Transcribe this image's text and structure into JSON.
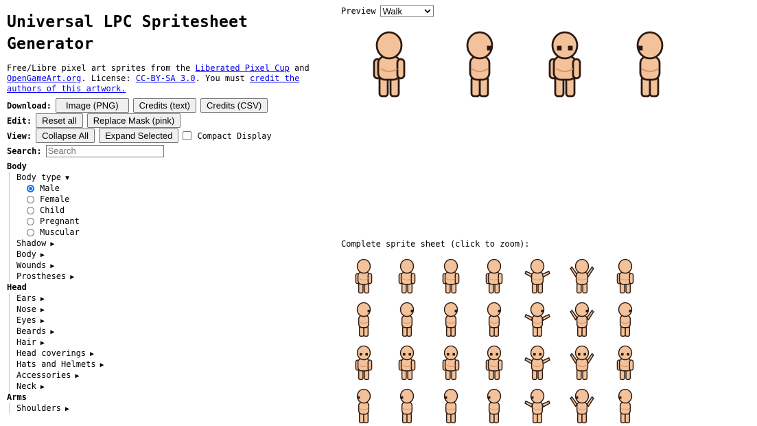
{
  "title": "Universal LPC Spritesheet Generator",
  "intro": {
    "t1": "Free/Libre pixel art sprites from the ",
    "link1": "Liberated Pixel Cup",
    "t2": " and ",
    "link2": "OpenGameArt.org",
    "t3": ". License: ",
    "link3": "CC-BY-SA 3.0",
    "t4": ". You must ",
    "link4": "credit the authors of this artwork."
  },
  "download": {
    "label": "Download:",
    "png": "Image (PNG)",
    "credits_text": "Credits (text)",
    "credits_csv": "Credits (CSV)"
  },
  "edit": {
    "label": "Edit:",
    "reset": "Reset all",
    "replace_mask": "Replace Mask (pink)"
  },
  "view": {
    "label": "View:",
    "collapse": "Collapse All",
    "expand": "Expand Selected",
    "compact": "Compact Display"
  },
  "search": {
    "label": "Search:",
    "placeholder": "Search"
  },
  "tree": {
    "body": {
      "label": "Body",
      "body_type": {
        "label": "Body type",
        "arrow": "▼",
        "options": [
          "Male",
          "Female",
          "Child",
          "Pregnant",
          "Muscular"
        ],
        "selected": "Male"
      },
      "items": [
        "Shadow",
        "Body",
        "Wounds",
        "Prostheses"
      ]
    },
    "head": {
      "label": "Head",
      "items": [
        "Ears",
        "Nose",
        "Eyes",
        "Beards",
        "Hair",
        "Head coverings",
        "Hats and Helmets",
        "Accessories",
        "Neck"
      ]
    },
    "arms": {
      "label": "Arms",
      "items": [
        "Shoulders"
      ]
    },
    "collapsed_arrow": "▶"
  },
  "preview": {
    "label": "Preview",
    "animation": "Walk"
  },
  "sheet": {
    "label": "Complete sprite sheet (click to zoom):"
  },
  "colors": {
    "skin": "#f3c29a",
    "skin_shade": "#d89468",
    "outline": "#2b1a12",
    "link": "#0000ee",
    "radio": "#0075ff"
  }
}
